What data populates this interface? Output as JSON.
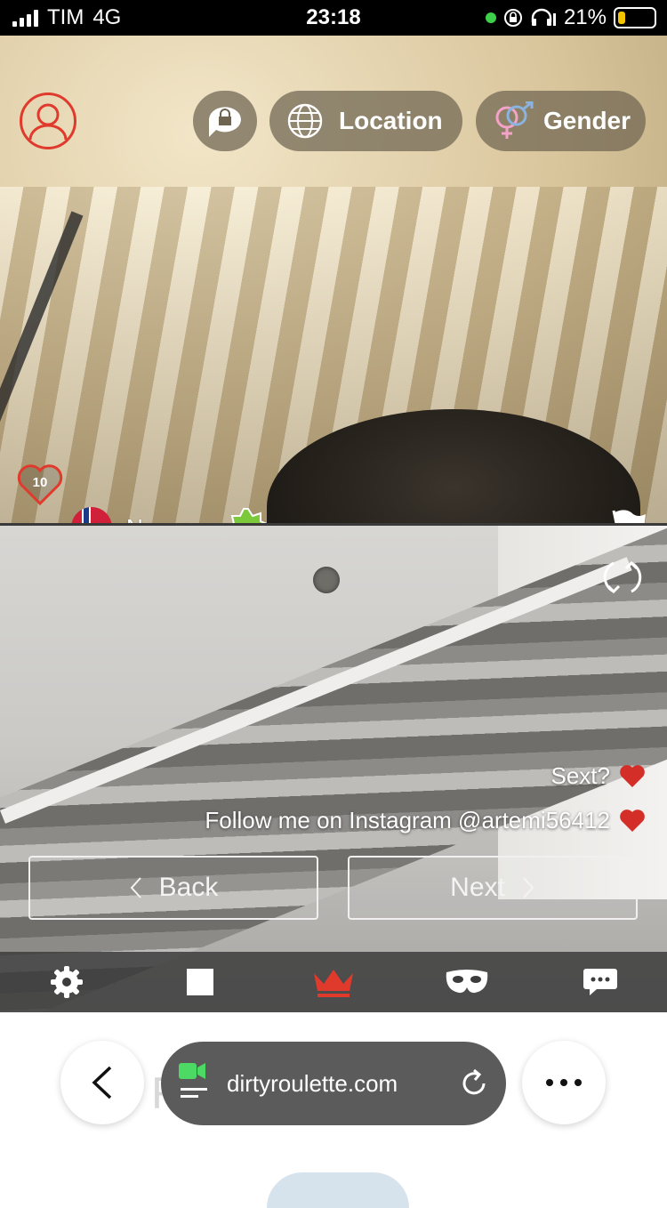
{
  "status_bar": {
    "carrier": "TIM",
    "network": "4G",
    "time": "23:18",
    "battery": "21%",
    "battery_level": 0.21
  },
  "top_video": {
    "location_label": "Location",
    "gender_label": "Gender",
    "likes_count": "10",
    "country": "Norway",
    "verified_badge": "V"
  },
  "bottom_video": {
    "messages": [
      {
        "text": "Sext?"
      },
      {
        "text": "Follow me on Instagram @artemi56412"
      }
    ],
    "back_label": "Back",
    "next_label": "Next"
  },
  "toolbar": {
    "icons": [
      "gear-icon",
      "stop-icon",
      "crown-icon",
      "mask-icon",
      "chat-icon"
    ],
    "accent_color": "#e03a2c"
  },
  "browser": {
    "url": "dirtyroulette.com"
  }
}
